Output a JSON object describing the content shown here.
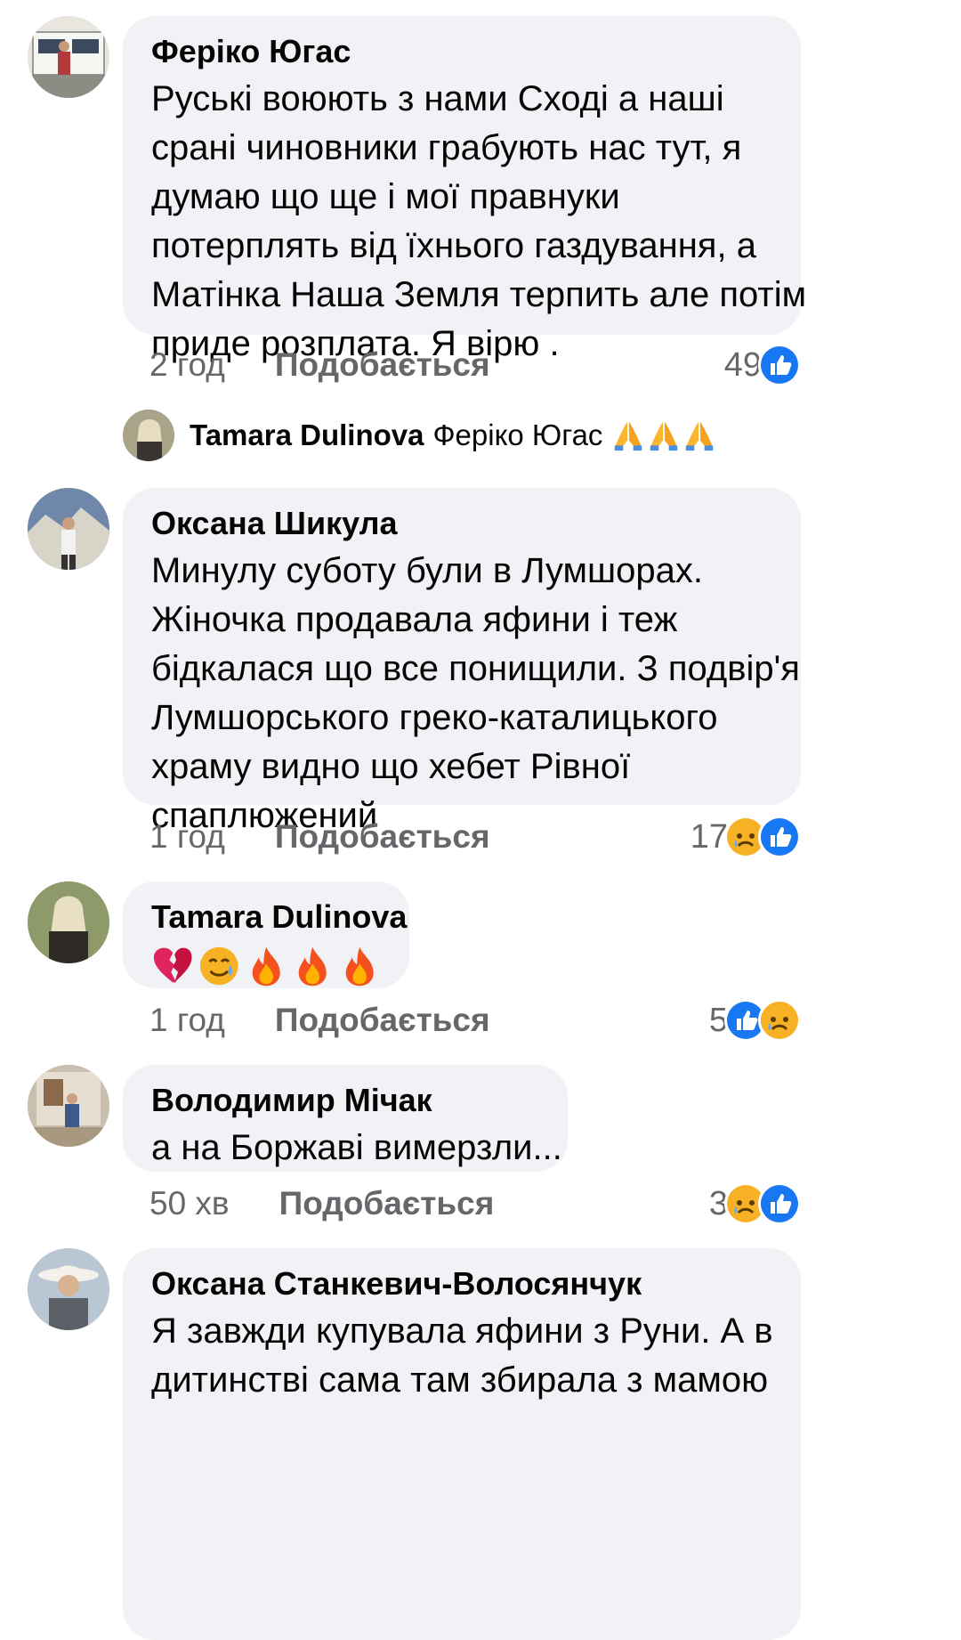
{
  "like_label": "Подобається",
  "comments": [
    {
      "author": "Феріко Югас",
      "lines": [
        "Руські воюють з нами Сході а наші",
        "срані чиновники грабують нас тут, я",
        "думаю що ще і мої правнуки",
        "потерплять від їхнього газдування, а",
        "Матінка Наша Земля терпить але потім",
        "приде розплата. Я вірю ."
      ],
      "time": "2 год",
      "reaction_count": "49",
      "reactions": [
        "like-icon"
      ]
    },
    {
      "author": "Оксана Шикула",
      "lines": [
        "Минулу суботу були в Лумшорах.",
        "Жіночка продавала яфини і теж",
        "бідкалася що все понищили. З подвір'я",
        "Лумшорського греко-каталицького",
        "храму видно що хебет Рівної",
        "спаплюжений"
      ],
      "time": "1 год",
      "reaction_count": "17",
      "reactions": [
        "sad-icon",
        "like-icon"
      ]
    },
    {
      "author": "Tamara Dulinova",
      "emojis": [
        "broken-heart-icon",
        "crying-smile-icon",
        "fire-icon",
        "fire-icon",
        "fire-icon"
      ],
      "time": "1 год",
      "reaction_count": "5",
      "reactions": [
        "like-icon",
        "sad-icon"
      ]
    },
    {
      "author": "Володимир Мічак",
      "lines": [
        "а на Боржаві вимерзли..."
      ],
      "time": "50 хв",
      "reaction_count": "3",
      "reactions": [
        "sad-icon",
        "like-icon"
      ]
    },
    {
      "author": "Оксана Станкевич-Волосянчук",
      "lines": [
        "Я  завжди купувала яфини з Руни. А в",
        "дитинстві сама там збирала з мамою"
      ]
    }
  ],
  "reply": {
    "author": "Tamara Dulinova",
    "mention": "Феріко Югас",
    "emojis": [
      "folded-hands-icon",
      "folded-hands-icon",
      "folded-hands-icon"
    ]
  },
  "colors": {
    "bubble": "#f0f2f5",
    "like_blue": "#1877f2",
    "meta_gray": "#65676b",
    "sad_yellow": "#f7b125"
  }
}
